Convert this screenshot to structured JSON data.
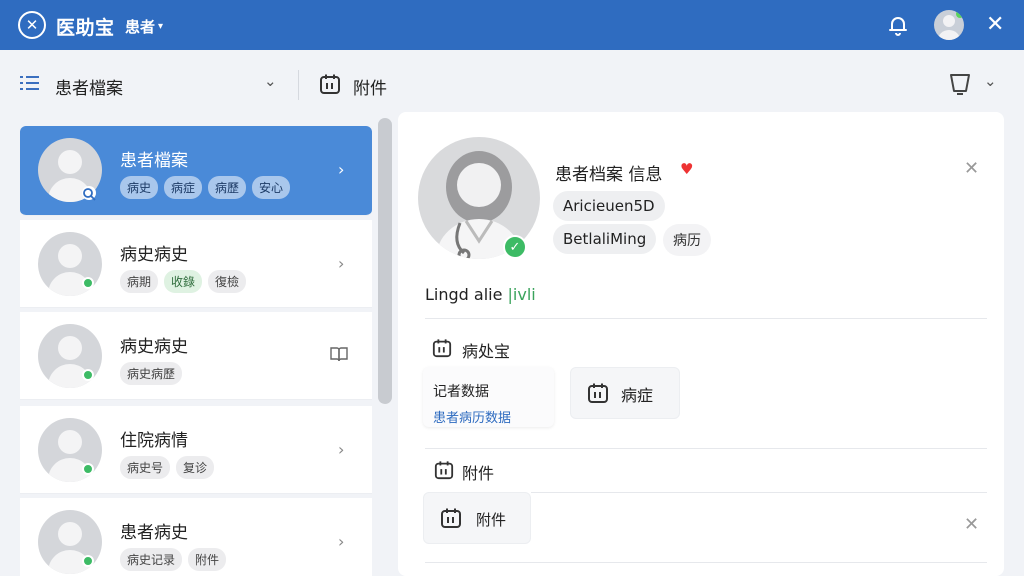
{
  "topbar": {
    "logo_glyph": "✕",
    "title": "医助宝",
    "subtitle": "患者",
    "close_glyph": "✕"
  },
  "toolbar": {
    "title": "患者檔案",
    "attach_label": "附件"
  },
  "patients": [
    {
      "name": "患者檔案",
      "tags": [
        "病史",
        "病症",
        "病歷",
        "安心"
      ],
      "active": true
    },
    {
      "name": "病史病史",
      "tags": [
        "病期",
        "收錄",
        "復檢"
      ],
      "active": false
    },
    {
      "name": "病史病史",
      "tags": [
        "病史病歷"
      ],
      "active": false
    },
    {
      "name": "住院病情",
      "tags": [
        "病史号",
        "复诊"
      ],
      "active": false
    },
    {
      "name": "患者病史",
      "tags": [
        "病史记录",
        "附件"
      ],
      "active": false
    }
  ],
  "detail": {
    "name": "患者档案 信息",
    "chip1": "Aricieuen5D",
    "chip2": "BetlaliMing",
    "chip3": "病历",
    "line_text": "Lingd alie",
    "line_accent": "|ivli",
    "section1_title": "病处宝",
    "card1_title": "记者数据",
    "card1_link": "患者病历数据",
    "card2_label": "病症",
    "section2_title": "附件",
    "card3_label": "附件"
  },
  "colors": {
    "brand": "#2f6cc0",
    "active_item": "#4a8ad8",
    "online": "#3dbb65"
  },
  "icons": [
    "close-icon",
    "bell-icon",
    "avatar",
    "list-icon",
    "chevron-down-icon",
    "calendar-icon",
    "trash-icon",
    "chevron-right-icon",
    "book-icon",
    "heart-icon",
    "check-icon"
  ]
}
